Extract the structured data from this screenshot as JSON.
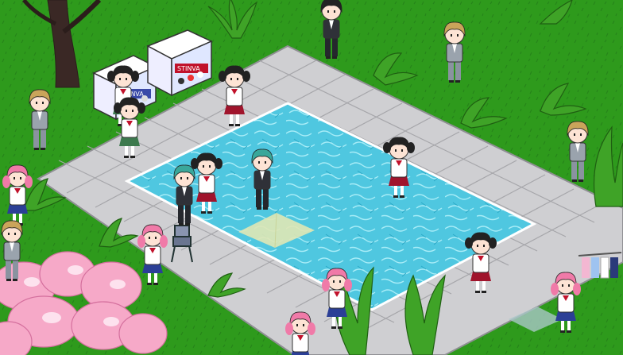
{
  "scene": {
    "colors": {
      "grass": "#2e9a1c",
      "grass_dark": "#26851a",
      "tile": "#cfcfd2",
      "tile_line": "#a6a6aa",
      "water": "#4fc7e0",
      "water_light": "#a7ecf7",
      "sakura": "#f6a9c8",
      "leaf": "#3fa327"
    },
    "stall_signs": [
      "STINVA",
      "STINVA"
    ]
  }
}
